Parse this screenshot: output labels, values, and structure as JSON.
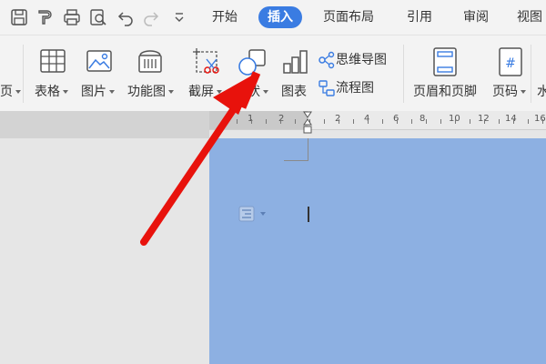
{
  "quick_access": {
    "icons": [
      "save-icon",
      "format-painter-icon",
      "print-icon",
      "print-preview-icon",
      "undo-icon",
      "redo-icon",
      "customize-icon"
    ]
  },
  "menu_tabs": [
    {
      "label": "开始",
      "active": false
    },
    {
      "label": "插入",
      "active": true
    },
    {
      "label": "页面布局",
      "active": false
    },
    {
      "label": "引用",
      "active": false
    },
    {
      "label": "审阅",
      "active": false
    },
    {
      "label": "视图",
      "active": false
    }
  ],
  "ribbon": {
    "page_partial": "页",
    "table": "表格",
    "picture": "图片",
    "function_chart": "功能图",
    "screenshot": "截屏",
    "shapes": "形状",
    "chart": "图表",
    "mind_map": "思维导图",
    "flowchart": "流程图",
    "header_footer": "页眉和页脚",
    "page_number": "页码",
    "watermark_partial": "水"
  },
  "ruler": {
    "numbers": [
      "1",
      "2",
      "2",
      "4",
      "6",
      "8",
      "10",
      "12",
      "14",
      "16"
    ]
  },
  "colors": {
    "accent": "#3a7ce2",
    "page": "#8db0e2",
    "annotation_arrow": "#e8120c"
  }
}
